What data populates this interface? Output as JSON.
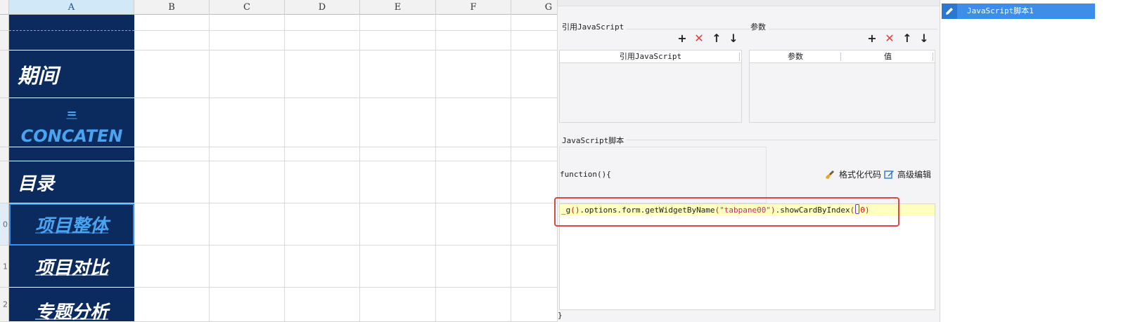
{
  "sheet": {
    "columns": [
      "A",
      "B",
      "C",
      "D",
      "E",
      "F",
      "G"
    ],
    "row_numbers": [
      "0",
      "1",
      "2"
    ],
    "a_cells": [
      "期间",
      "=",
      "CONCATEN",
      "目录",
      "项目整体",
      "项目对比",
      "专题分析"
    ]
  },
  "panel": {
    "ref_js_label": "引用JavaScript",
    "params_label": "参数",
    "ref_js_column": "引用JavaScript",
    "param_column": "参数",
    "value_column": "值",
    "script_label": "JavaScript脚本",
    "fn_open": "function(){",
    "fn_close": "}",
    "format_code": "格式化代码",
    "advanced_edit": "高级编辑",
    "code": {
      "p1": "_g",
      "r1": "()",
      "p2": ".options.form.getWidgetByName",
      "r2": "(",
      "s1": "\"tabpane00\"",
      "r3": ")",
      "p3": ".showCardByIndex",
      "r4": "(",
      "r5": "0",
      "r6": ")"
    }
  },
  "right_list": {
    "items": [
      "JavaScript脚本1"
    ]
  },
  "colors": {
    "sheet_a_bg": "#0b2a5e",
    "accent": "#3d8ee8",
    "highlight_red": "#e04545",
    "code_line_bg": "#ffffc0"
  }
}
